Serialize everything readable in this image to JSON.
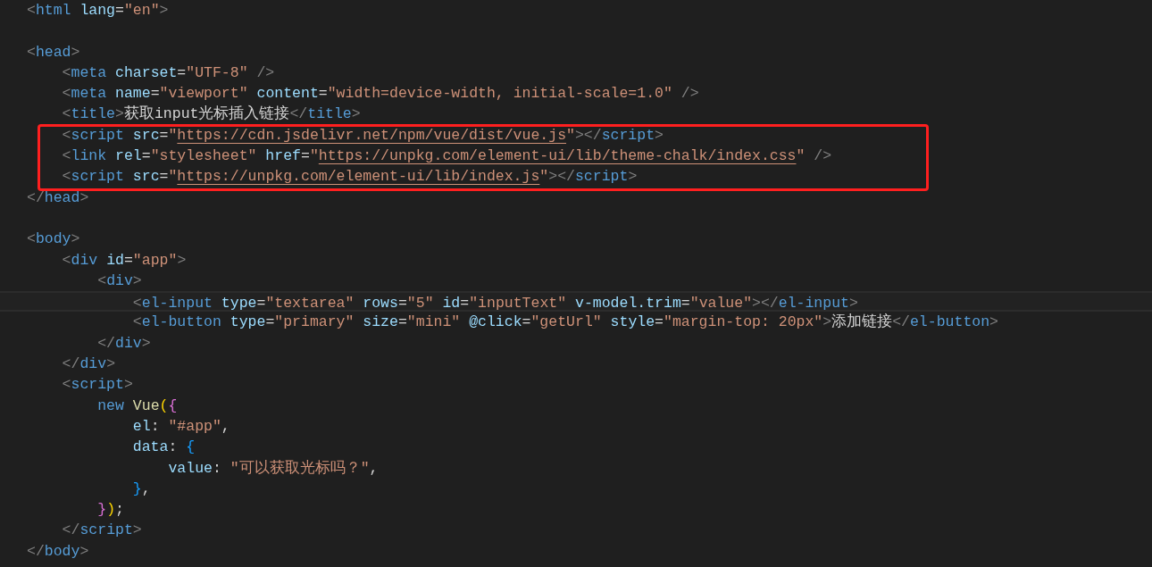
{
  "editor": {
    "lines": [
      {
        "kind": "code",
        "current": false,
        "tokens": [
          {
            "t": "<",
            "kind": "p"
          },
          {
            "t": "html",
            "kind": "tag"
          },
          {
            "t": " lang",
            "kind": "attr"
          },
          {
            "t": "=",
            "kind": "txt"
          },
          {
            "t": "\"en\"",
            "kind": "str"
          },
          {
            "t": ">",
            "kind": "p"
          }
        ]
      },
      {
        "kind": "blank",
        "current": false
      },
      {
        "kind": "code",
        "current": false,
        "tokens": [
          {
            "t": "<",
            "kind": "p"
          },
          {
            "t": "head",
            "kind": "tag"
          },
          {
            "t": ">",
            "kind": "p"
          }
        ]
      },
      {
        "kind": "code",
        "current": false,
        "tokens": [
          {
            "t": "    <",
            "kind": "p"
          },
          {
            "t": "meta",
            "kind": "tag"
          },
          {
            "t": " charset",
            "kind": "attr"
          },
          {
            "t": "=",
            "kind": "txt"
          },
          {
            "t": "\"UTF-8\"",
            "kind": "str"
          },
          {
            "t": " />",
            "kind": "p"
          }
        ]
      },
      {
        "kind": "code",
        "current": false,
        "tokens": [
          {
            "t": "    <",
            "kind": "p"
          },
          {
            "t": "meta",
            "kind": "tag"
          },
          {
            "t": " name",
            "kind": "attr"
          },
          {
            "t": "=",
            "kind": "txt"
          },
          {
            "t": "\"viewport\"",
            "kind": "str"
          },
          {
            "t": " content",
            "kind": "attr"
          },
          {
            "t": "=",
            "kind": "txt"
          },
          {
            "t": "\"width=device-width, initial-scale=1.0\"",
            "kind": "str"
          },
          {
            "t": " />",
            "kind": "p"
          }
        ]
      },
      {
        "kind": "code",
        "current": false,
        "tokens": [
          {
            "t": "    <",
            "kind": "p"
          },
          {
            "t": "title",
            "kind": "tag"
          },
          {
            "t": ">",
            "kind": "p"
          },
          {
            "t": "获取input光标插入链接",
            "kind": "txt"
          },
          {
            "t": "</",
            "kind": "p"
          },
          {
            "t": "title",
            "kind": "tag"
          },
          {
            "t": ">",
            "kind": "p"
          }
        ]
      },
      {
        "kind": "code",
        "current": false,
        "tokens": [
          {
            "t": "    <",
            "kind": "p"
          },
          {
            "t": "script",
            "kind": "tag"
          },
          {
            "t": " src",
            "kind": "attr"
          },
          {
            "t": "=",
            "kind": "txt"
          },
          {
            "t": "\"",
            "kind": "str"
          },
          {
            "t": "https://cdn.jsdelivr.net/npm/vue/dist/vue.js",
            "kind": "url"
          },
          {
            "t": "\"",
            "kind": "str"
          },
          {
            "t": "></",
            "kind": "p"
          },
          {
            "t": "script",
            "kind": "tag"
          },
          {
            "t": ">",
            "kind": "p"
          }
        ]
      },
      {
        "kind": "code",
        "current": false,
        "tokens": [
          {
            "t": "    <",
            "kind": "p"
          },
          {
            "t": "link",
            "kind": "tag"
          },
          {
            "t": " rel",
            "kind": "attr"
          },
          {
            "t": "=",
            "kind": "txt"
          },
          {
            "t": "\"stylesheet\"",
            "kind": "str"
          },
          {
            "t": " href",
            "kind": "attr"
          },
          {
            "t": "=",
            "kind": "txt"
          },
          {
            "t": "\"",
            "kind": "str"
          },
          {
            "t": "https://unpkg.com/element-ui/lib/theme-chalk/index.css",
            "kind": "url"
          },
          {
            "t": "\"",
            "kind": "str"
          },
          {
            "t": " />",
            "kind": "p"
          }
        ]
      },
      {
        "kind": "code",
        "current": false,
        "tokens": [
          {
            "t": "    <",
            "kind": "p"
          },
          {
            "t": "script",
            "kind": "tag"
          },
          {
            "t": " src",
            "kind": "attr"
          },
          {
            "t": "=",
            "kind": "txt"
          },
          {
            "t": "\"",
            "kind": "str"
          },
          {
            "t": "https://unpkg.com/element-ui/lib/index.js",
            "kind": "url"
          },
          {
            "t": "\"",
            "kind": "str"
          },
          {
            "t": "></",
            "kind": "p"
          },
          {
            "t": "script",
            "kind": "tag"
          },
          {
            "t": ">",
            "kind": "p"
          }
        ]
      },
      {
        "kind": "code",
        "current": false,
        "tokens": [
          {
            "t": "</",
            "kind": "p"
          },
          {
            "t": "head",
            "kind": "tag"
          },
          {
            "t": ">",
            "kind": "p"
          }
        ]
      },
      {
        "kind": "blank",
        "current": false
      },
      {
        "kind": "code",
        "current": false,
        "tokens": [
          {
            "t": "<",
            "kind": "p"
          },
          {
            "t": "body",
            "kind": "tag"
          },
          {
            "t": ">",
            "kind": "p"
          }
        ]
      },
      {
        "kind": "code",
        "current": false,
        "tokens": [
          {
            "t": "    <",
            "kind": "p"
          },
          {
            "t": "div",
            "kind": "tag"
          },
          {
            "t": " id",
            "kind": "attr"
          },
          {
            "t": "=",
            "kind": "txt"
          },
          {
            "t": "\"app\"",
            "kind": "str"
          },
          {
            "t": ">",
            "kind": "p"
          }
        ]
      },
      {
        "kind": "code",
        "current": false,
        "tokens": [
          {
            "t": "        <",
            "kind": "p"
          },
          {
            "t": "div",
            "kind": "tag"
          },
          {
            "t": ">",
            "kind": "p"
          }
        ]
      },
      {
        "kind": "code",
        "current": true,
        "tokens": [
          {
            "t": "            <",
            "kind": "p"
          },
          {
            "t": "el-input",
            "kind": "tag"
          },
          {
            "t": " type",
            "kind": "attr"
          },
          {
            "t": "=",
            "kind": "txt"
          },
          {
            "t": "\"textarea\"",
            "kind": "str"
          },
          {
            "t": " rows",
            "kind": "attr"
          },
          {
            "t": "=",
            "kind": "txt"
          },
          {
            "t": "\"5\"",
            "kind": "str"
          },
          {
            "t": " id",
            "kind": "attr"
          },
          {
            "t": "=",
            "kind": "txt"
          },
          {
            "t": "\"inputText\"",
            "kind": "str"
          },
          {
            "t": " v-model.trim",
            "kind": "attr"
          },
          {
            "t": "=",
            "kind": "txt"
          },
          {
            "t": "\"value\"",
            "kind": "str"
          },
          {
            "t": "></",
            "kind": "p"
          },
          {
            "t": "el-input",
            "kind": "tag"
          },
          {
            "t": ">",
            "kind": "p"
          }
        ]
      },
      {
        "kind": "code",
        "current": false,
        "tokens": [
          {
            "t": "            <",
            "kind": "p"
          },
          {
            "t": "el-button",
            "kind": "tag"
          },
          {
            "t": " type",
            "kind": "attr"
          },
          {
            "t": "=",
            "kind": "txt"
          },
          {
            "t": "\"primary\"",
            "kind": "str"
          },
          {
            "t": " size",
            "kind": "attr"
          },
          {
            "t": "=",
            "kind": "txt"
          },
          {
            "t": "\"mini\"",
            "kind": "str"
          },
          {
            "t": " @click",
            "kind": "attr"
          },
          {
            "t": "=",
            "kind": "txt"
          },
          {
            "t": "\"getUrl\"",
            "kind": "str"
          },
          {
            "t": " style",
            "kind": "attr"
          },
          {
            "t": "=",
            "kind": "txt"
          },
          {
            "t": "\"margin-top: 20px\"",
            "kind": "str"
          },
          {
            "t": ">",
            "kind": "p"
          },
          {
            "t": "添加链接",
            "kind": "txt"
          },
          {
            "t": "</",
            "kind": "p"
          },
          {
            "t": "el-button",
            "kind": "tag"
          },
          {
            "t": ">",
            "kind": "p"
          }
        ]
      },
      {
        "kind": "code",
        "current": false,
        "tokens": [
          {
            "t": "        </",
            "kind": "p"
          },
          {
            "t": "div",
            "kind": "tag"
          },
          {
            "t": ">",
            "kind": "p"
          }
        ]
      },
      {
        "kind": "code",
        "current": false,
        "tokens": [
          {
            "t": "    </",
            "kind": "p"
          },
          {
            "t": "div",
            "kind": "tag"
          },
          {
            "t": ">",
            "kind": "p"
          }
        ]
      },
      {
        "kind": "code",
        "current": false,
        "tokens": [
          {
            "t": "    <",
            "kind": "p"
          },
          {
            "t": "script",
            "kind": "tag"
          },
          {
            "t": ">",
            "kind": "p"
          }
        ]
      },
      {
        "kind": "code",
        "current": false,
        "tokens": [
          {
            "t": "        new",
            "kind": "kw"
          },
          {
            "t": " Vue",
            "kind": "fn"
          },
          {
            "t": "(",
            "kind": "b1"
          },
          {
            "t": "{",
            "kind": "b2"
          }
        ]
      },
      {
        "kind": "code",
        "current": false,
        "tokens": [
          {
            "t": "            el",
            "kind": "attr"
          },
          {
            "t": ": ",
            "kind": "txt"
          },
          {
            "t": "\"#app\"",
            "kind": "str"
          },
          {
            "t": ",",
            "kind": "txt"
          }
        ]
      },
      {
        "kind": "code",
        "current": false,
        "tokens": [
          {
            "t": "            data",
            "kind": "attr"
          },
          {
            "t": ": ",
            "kind": "txt"
          },
          {
            "t": "{",
            "kind": "b3"
          }
        ]
      },
      {
        "kind": "code",
        "current": false,
        "tokens": [
          {
            "t": "                value",
            "kind": "attr"
          },
          {
            "t": ": ",
            "kind": "txt"
          },
          {
            "t": "\"可以获取光标吗？\"",
            "kind": "str"
          },
          {
            "t": ",",
            "kind": "txt"
          }
        ]
      },
      {
        "kind": "code",
        "current": false,
        "tokens": [
          {
            "t": "            }",
            "kind": "b3"
          },
          {
            "t": ",",
            "kind": "txt"
          }
        ]
      },
      {
        "kind": "code",
        "current": false,
        "tokens": [
          {
            "t": "        }",
            "kind": "b2"
          },
          {
            "t": ")",
            "kind": "b1"
          },
          {
            "t": ";",
            "kind": "txt"
          }
        ]
      },
      {
        "kind": "code",
        "current": false,
        "tokens": [
          {
            "t": "    </",
            "kind": "p"
          },
          {
            "t": "script",
            "kind": "tag"
          },
          {
            "t": ">",
            "kind": "p"
          }
        ]
      },
      {
        "kind": "code",
        "current": false,
        "tokens": [
          {
            "t": "</",
            "kind": "p"
          },
          {
            "t": "body",
            "kind": "tag"
          },
          {
            "t": ">",
            "kind": "p"
          }
        ]
      }
    ]
  }
}
